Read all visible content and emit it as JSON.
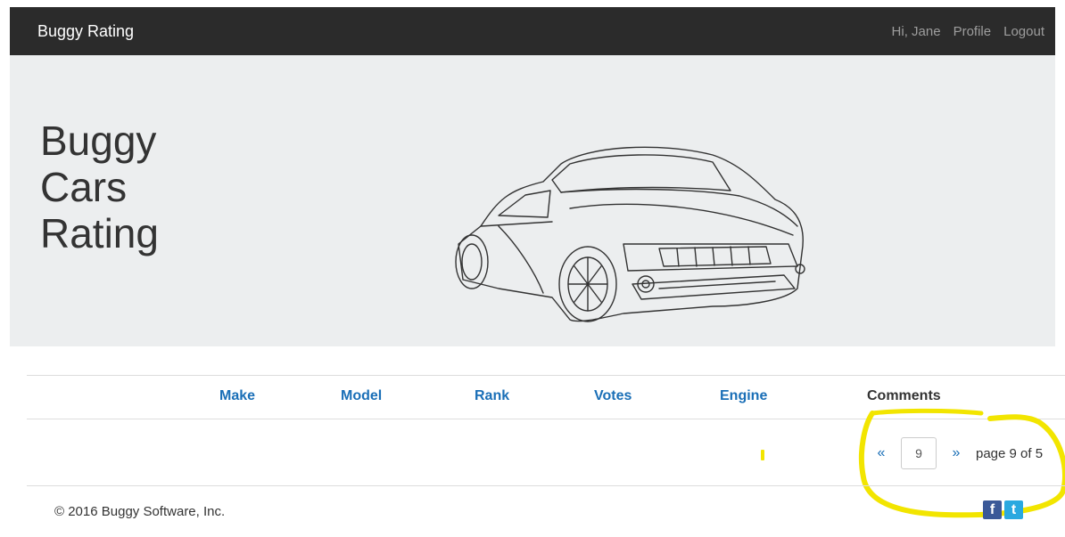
{
  "navbar": {
    "brand": "Buggy Rating",
    "greeting": "Hi, Jane",
    "profile_label": "Profile",
    "logout_label": "Logout"
  },
  "hero": {
    "title_line1": "Buggy",
    "title_line2": "Cars",
    "title_line3": "Rating"
  },
  "table": {
    "columns": [
      "Make",
      "Model",
      "Rank",
      "Votes",
      "Engine",
      "Comments"
    ]
  },
  "pager": {
    "prev": "«",
    "current_page": "9",
    "next": "»",
    "status": "page 9 of 5"
  },
  "footer": {
    "copyright": "© 2016 Buggy Software, Inc.",
    "facebook_glyph": "f",
    "twitter_glyph": "t"
  },
  "colors": {
    "navbar_bg": "#2b2b2b",
    "hero_bg": "#eceeef",
    "link": "#1a6fb7",
    "annotation": "#f2e500"
  }
}
